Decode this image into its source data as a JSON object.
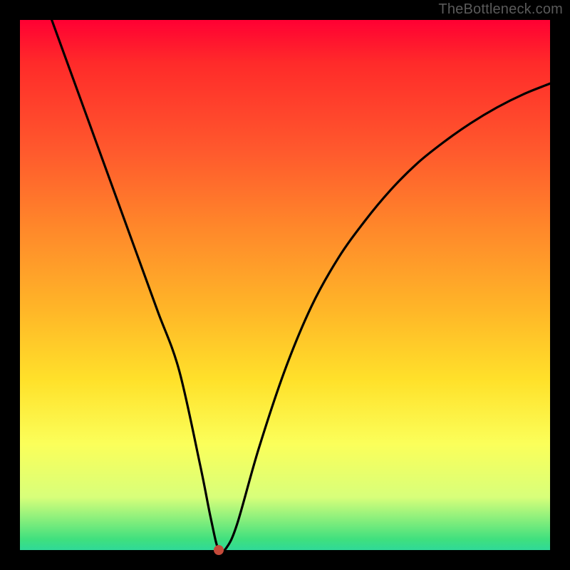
{
  "watermark": "TheBottleneck.com",
  "chart_data": {
    "type": "line",
    "title": "",
    "xlabel": "",
    "ylabel": "",
    "xlim": [
      0,
      100
    ],
    "ylim": [
      0,
      100
    ],
    "grid": false,
    "legend": false,
    "annotations": [],
    "series": [
      {
        "name": "curve",
        "color": "#000000",
        "x": [
          6,
          10,
          14,
          18,
          22,
          26,
          30,
          34,
          36,
          37.5,
          39,
          41,
          45,
          50,
          55,
          60,
          65,
          70,
          75,
          80,
          85,
          90,
          95,
          100
        ],
        "values": [
          100,
          89,
          78,
          67,
          56,
          45,
          34,
          16,
          6,
          0,
          0.5,
          5,
          19,
          34,
          46,
          55,
          62,
          68,
          73,
          77,
          80.5,
          83.5,
          86,
          88
        ]
      }
    ],
    "marker": {
      "x": 37.5,
      "y": 0,
      "color": "#c54a3a"
    },
    "background_gradient": {
      "top": "#ff0033",
      "mid_top": "#ff8a2a",
      "mid": "#ffe12a",
      "mid_bottom": "#d8ff7a",
      "bottom": "#30d998"
    }
  }
}
